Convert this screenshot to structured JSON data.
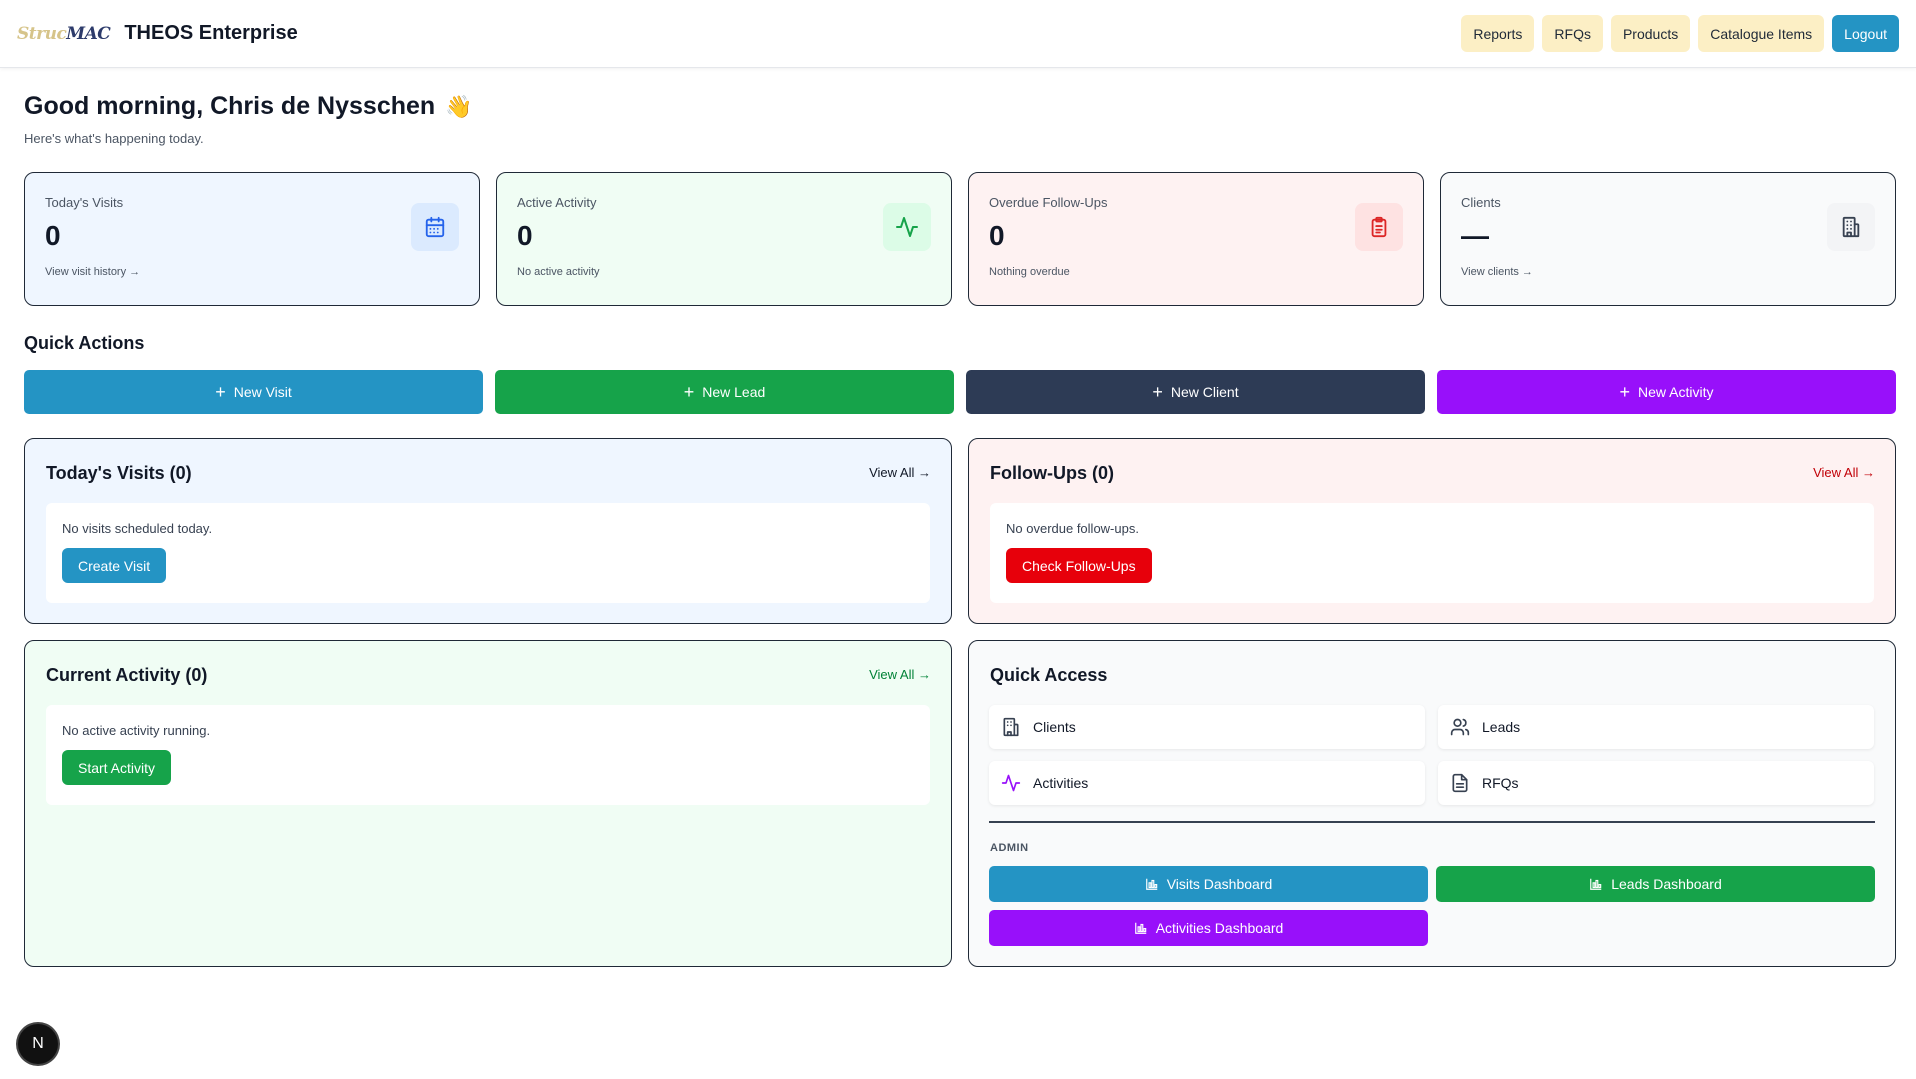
{
  "header": {
    "logo_part1": "Struc",
    "logo_part2": "MAC",
    "brand": "THEOS Enterprise",
    "nav": [
      "Reports",
      "RFQs",
      "Products",
      "Catalogue Items"
    ],
    "logout": "Logout"
  },
  "greeting": {
    "title": "Good morning, Chris de Nysschen",
    "emoji": "👋",
    "subtitle": "Here's what's happening today."
  },
  "stats": [
    {
      "label": "Today's Visits",
      "value": "0",
      "link": "View visit history →",
      "icon": "calendar-icon"
    },
    {
      "label": "Active Activity",
      "value": "0",
      "link": "No active activity",
      "icon": "activity-icon"
    },
    {
      "label": "Overdue Follow-Ups",
      "value": "0",
      "link": "Nothing overdue",
      "icon": "clipboard-icon"
    },
    {
      "label": "Clients",
      "value": "—",
      "link": "View clients →",
      "icon": "building-icon"
    }
  ],
  "quick_actions": {
    "title": "Quick Actions",
    "buttons": [
      "New Visit",
      "New Lead",
      "New Client",
      "New Activity"
    ]
  },
  "panels": {
    "visits": {
      "title": "Today's Visits (0)",
      "view_all": "View All →",
      "message": "No visits scheduled today.",
      "button": "Create Visit"
    },
    "followups": {
      "title": "Follow-Ups (0)",
      "view_all": "View All →",
      "message": "No overdue follow-ups.",
      "button": "Check Follow-Ups"
    },
    "activity": {
      "title": "Current Activity (0)",
      "view_all": "View All →",
      "message": "No active activity running.",
      "button": "Start Activity"
    },
    "quick_access": {
      "title": "Quick Access",
      "items": [
        "Clients",
        "Leads",
        "Activities",
        "RFQs"
      ],
      "admin_label": "ADMIN",
      "dashboards": [
        "Visits Dashboard",
        "Leads Dashboard",
        "Activities Dashboard"
      ]
    }
  },
  "badge": "N",
  "colors": {
    "blue": "#2494c4",
    "green": "#16a34a",
    "dark": "#2d3b55",
    "purple": "#9810fa",
    "red": "#e7000b",
    "nav_pill": "#fcefc5"
  }
}
